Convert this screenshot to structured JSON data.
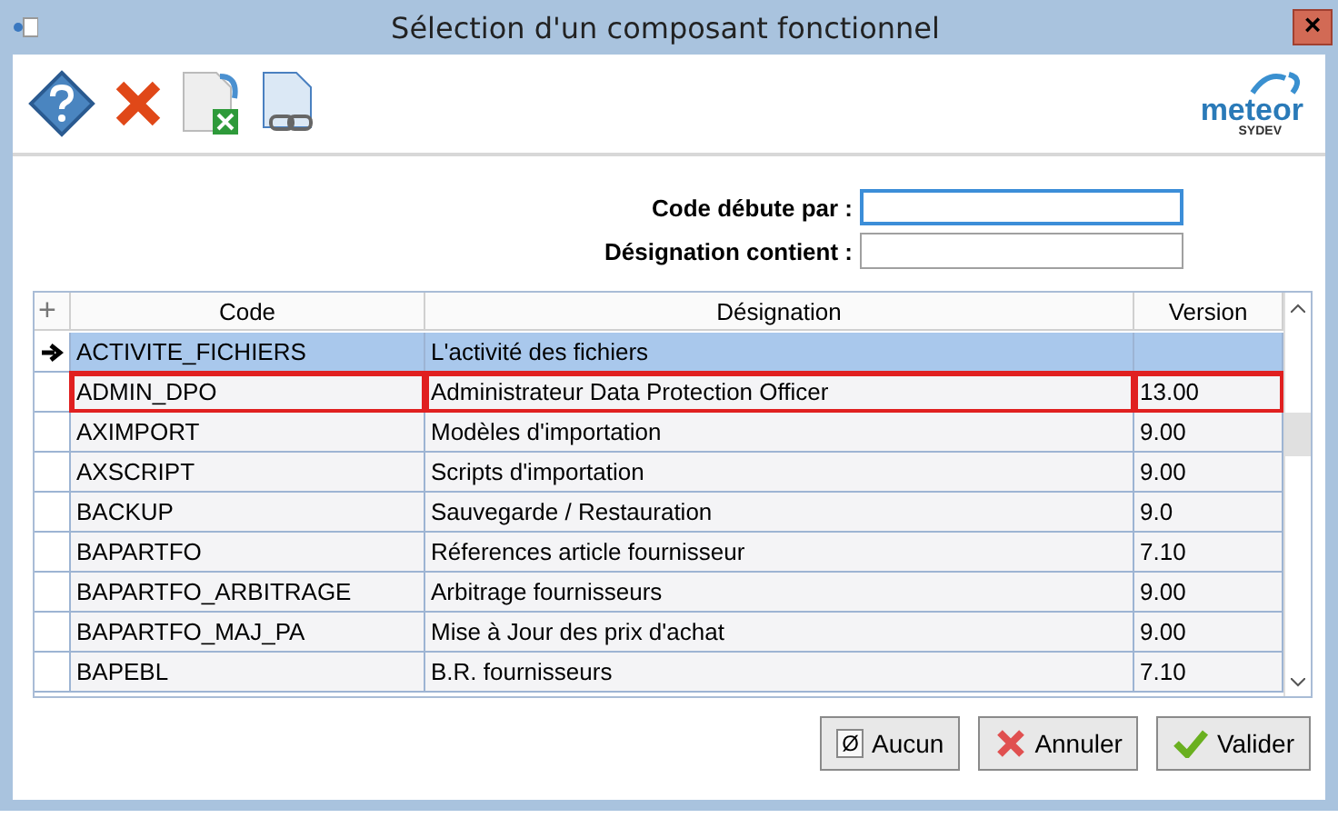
{
  "window": {
    "title": "Sélection d'un composant fonctionnel",
    "close": "×"
  },
  "logo": {
    "name": "meteor",
    "sub": "SYDEV"
  },
  "form": [
    {
      "label": "Code débute par :",
      "focused": true
    },
    {
      "label": "Désignation contient :",
      "focused": false
    }
  ],
  "table": {
    "add": "+",
    "columns": [
      "Code",
      "Désignation",
      "Version"
    ],
    "rows": [
      {
        "code": "ACTIVITE_FICHIERS",
        "designation": "L'activité des fichiers",
        "version": "",
        "selected": true,
        "circled": false
      },
      {
        "code": "ADMIN_DPO",
        "designation": "Administrateur Data Protection Officer",
        "version": "13.00",
        "selected": false,
        "circled": true
      },
      {
        "code": "AXIMPORT",
        "designation": "Modèles d'importation",
        "version": "9.00",
        "selected": false,
        "circled": false
      },
      {
        "code": "AXSCRIPT",
        "designation": "Scripts d'importation",
        "version": "9.00",
        "selected": false,
        "circled": false
      },
      {
        "code": "BACKUP",
        "designation": "Sauvegarde / Restauration",
        "version": "9.0",
        "selected": false,
        "circled": false
      },
      {
        "code": "BAPARTFO",
        "designation": "Réferences article fournisseur",
        "version": "7.10",
        "selected": false,
        "circled": false
      },
      {
        "code": "BAPARTFO_ARBITRAGE",
        "designation": "Arbitrage fournisseurs",
        "version": "9.00",
        "selected": false,
        "circled": false
      },
      {
        "code": "BAPARTFO_MAJ_PA",
        "designation": "Mise à Jour des prix d'achat",
        "version": "9.00",
        "selected": false,
        "circled": false
      },
      {
        "code": "BAPEBL",
        "designation": "B.R. fournisseurs",
        "version": "7.10",
        "selected": false,
        "circled": false
      }
    ]
  },
  "buttons": [
    {
      "kind": "none",
      "label": "Aucun",
      "glyph": "Ø"
    },
    {
      "kind": "cancel",
      "label": "Annuler"
    },
    {
      "kind": "ok",
      "label": "Valider"
    }
  ]
}
